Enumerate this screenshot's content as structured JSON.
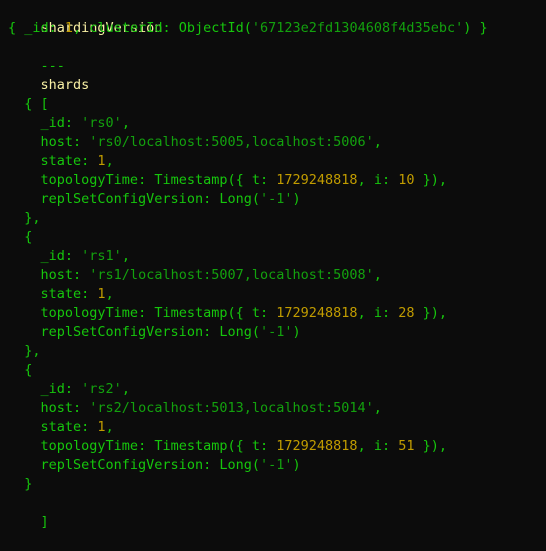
{
  "header": {
    "title": "shardingVersion",
    "version_doc": {
      "open": "{ ",
      "id_key": "_id",
      "colon": ": ",
      "id_val": "1",
      "comma": ", ",
      "cluster_key": "clusterId",
      "cluster_func": "ObjectId(",
      "cluster_val": "'67123e2fd1304608f4d35ebc'",
      "close": ") }"
    },
    "divider": "---"
  },
  "section": {
    "title": "shards",
    "array_open": "[",
    "array_close": "]"
  },
  "labels": {
    "obj_open": "  {",
    "obj_close_comma": "  },",
    "obj_close": "  }",
    "indent": "    ",
    "id_key": "_id",
    "host_key": "host",
    "state_key": "state",
    "topo_key": "topologyTime",
    "repl_key": "replSetConfigVersion",
    "colon": ": ",
    "comma": ",",
    "ts_func": "Timestamp({ ",
    "t_key": "t",
    "i_key": "i",
    "ts_sep": ", ",
    "ts_close": " }),",
    "long_func": "Long(",
    "long_close": ")"
  },
  "shards": [
    {
      "id": "'rs0'",
      "host": "'rs0/localhost:5005,localhost:5006'",
      "state": "1",
      "t": "1729248818",
      "i": "10",
      "repl": "'-1'"
    },
    {
      "id": "'rs1'",
      "host": "'rs1/localhost:5007,localhost:5008'",
      "state": "1",
      "t": "1729248818",
      "i": "28",
      "repl": "'-1'"
    },
    {
      "id": "'rs2'",
      "host": "'rs2/localhost:5013,localhost:5014'",
      "state": "1",
      "t": "1729248818",
      "i": "51",
      "repl": "'-1'"
    }
  ],
  "colors": {
    "background": "#0c0c0c",
    "heading": "#f9f1a5",
    "key": "#16c60c",
    "string": "#13a10e",
    "number": "#c19c00",
    "text": "#cccccc"
  }
}
